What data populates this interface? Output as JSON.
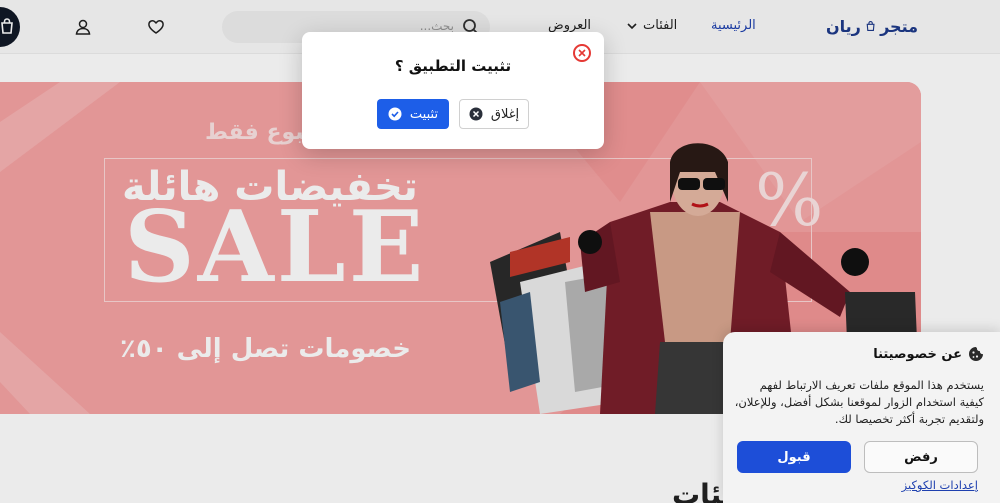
{
  "header": {
    "brand_word1": "متجر",
    "brand_word2": "ريان",
    "nav_home": "الرئيسية",
    "nav_categories": "الفئات",
    "nav_offers": "العروض",
    "search_placeholder": "بحث..."
  },
  "banner": {
    "line1": "لمدة أسبوع فقط",
    "title": "تخفيضات هائلة",
    "big_text": "SALE",
    "percent_symbol": "%",
    "subtitle": "خصومات تصل إلى ٥٠٪",
    "slide_count": 3,
    "active_slide": 1
  },
  "section": {
    "heading": "الفئات"
  },
  "install_modal": {
    "title": "تثبيت التطبيق ؟",
    "install_label": "تثبيت",
    "close_label": "إغلاق"
  },
  "cookie_panel": {
    "title": "عن خصوصيتنا",
    "text": "يستخدم هذا الموقع ملفات تعريف الارتباط لفهم كيفية استخدام الزوار لموقعنا بشكل أفضل، وللإعلان، ولتقديم تجربة أكثر تخصيصا لك.",
    "accept_label": "قبول",
    "reject_label": "رفض",
    "settings_label": "إعدادات الكوكيز"
  },
  "colors": {
    "brand": "#1e3a8a",
    "banner_bg": "#f6a3a3",
    "primary_button": "#1d5ee8",
    "close_icon": "#e53935"
  },
  "icons": {
    "brand": "shopping-bag-icon",
    "search": "search-icon",
    "favorites": "heart-icon",
    "account": "user-icon",
    "cart": "cart-icon",
    "modal_close": "close-circle-icon",
    "install": "check-circle-icon",
    "dismiss": "x-circle-icon",
    "cookie": "cookie-icon"
  }
}
